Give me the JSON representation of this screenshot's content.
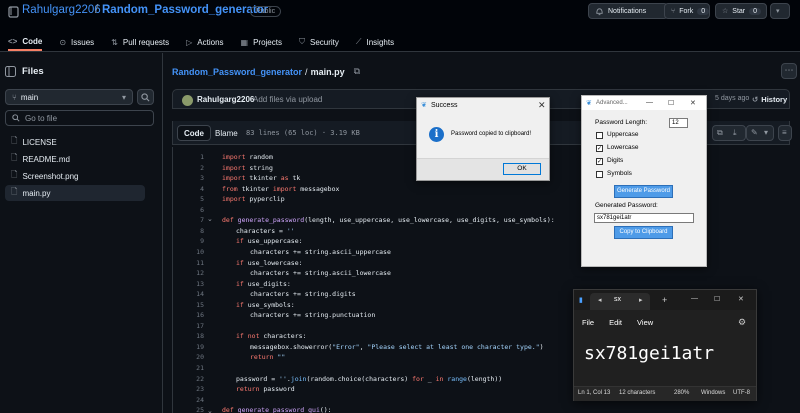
{
  "header": {
    "owner": "Rahulgarg2206",
    "separator": "/",
    "repo": "Random_Password_generator",
    "visibility": "Public",
    "notifications_label": "Notifications",
    "fork_label": "Fork",
    "fork_count": "0",
    "star_label": "Star",
    "star_count": "0"
  },
  "nav": [
    {
      "label": "Code",
      "icon": "code-icon",
      "active": true
    },
    {
      "label": "Issues",
      "icon": "issue-icon"
    },
    {
      "label": "Pull requests",
      "icon": "pull-request-icon"
    },
    {
      "label": "Actions",
      "icon": "play-icon"
    },
    {
      "label": "Projects",
      "icon": "table-icon"
    },
    {
      "label": "Security",
      "icon": "shield-icon"
    },
    {
      "label": "Insights",
      "icon": "graph-icon"
    }
  ],
  "tree": {
    "title": "Files",
    "branch": "main",
    "goto_placeholder": "Go to file",
    "files": [
      "LICENSE",
      "README.md",
      "Screenshot.png",
      "main.py"
    ]
  },
  "main": {
    "crumb_repo": "Random_Password_generator",
    "crumb_sep": "/",
    "crumb_file": "main.py",
    "commit_author": "Rahulgarg2206",
    "commit_message": "Add files via upload",
    "commit_time": "5 days ago",
    "history_label": "History",
    "code_tab": "Code",
    "blame_tab": "Blame",
    "file_meta": "83 lines (65 loc) · 3.19 KB"
  },
  "code_lines": [
    {
      "n": "1",
      "indent": 0,
      "parts": [
        [
          "kw",
          "import"
        ],
        [
          "t",
          " random"
        ]
      ]
    },
    {
      "n": "2",
      "indent": 0,
      "parts": [
        [
          "kw",
          "import"
        ],
        [
          "t",
          " string"
        ]
      ]
    },
    {
      "n": "3",
      "indent": 0,
      "parts": [
        [
          "kw",
          "import"
        ],
        [
          "t",
          " tkinter "
        ],
        [
          "kw",
          "as"
        ],
        [
          "t",
          " tk"
        ]
      ]
    },
    {
      "n": "4",
      "indent": 0,
      "parts": [
        [
          "kw",
          "from"
        ],
        [
          "t",
          " tkinter "
        ],
        [
          "kw",
          "import"
        ],
        [
          "t",
          " messagebox"
        ]
      ]
    },
    {
      "n": "5",
      "indent": 0,
      "parts": [
        [
          "kw",
          "import"
        ],
        [
          "t",
          " pyperclip"
        ]
      ]
    },
    {
      "n": "6",
      "indent": 0,
      "parts": []
    },
    {
      "n": "7",
      "indent": 0,
      "parts": [
        [
          "kw",
          "def"
        ],
        [
          "t",
          " "
        ],
        [
          "fn",
          "generate_password"
        ],
        [
          "t",
          "(length, use_uppercase, use_lowercase, use_digits, use_symbols):"
        ]
      ]
    },
    {
      "n": "8",
      "indent": 1,
      "parts": [
        [
          "t",
          "characters = "
        ],
        [
          "st",
          "''"
        ]
      ]
    },
    {
      "n": "9",
      "indent": 1,
      "parts": [
        [
          "kw",
          "if"
        ],
        [
          "t",
          " use_uppercase:"
        ]
      ]
    },
    {
      "n": "10",
      "indent": 2,
      "parts": [
        [
          "t",
          "characters += string.ascii_uppercase"
        ]
      ]
    },
    {
      "n": "11",
      "indent": 1,
      "parts": [
        [
          "kw",
          "if"
        ],
        [
          "t",
          " use_lowercase:"
        ]
      ]
    },
    {
      "n": "12",
      "indent": 2,
      "parts": [
        [
          "t",
          "characters += string.ascii_lowercase"
        ]
      ]
    },
    {
      "n": "13",
      "indent": 1,
      "parts": [
        [
          "kw",
          "if"
        ],
        [
          "t",
          " use_digits:"
        ]
      ]
    },
    {
      "n": "14",
      "indent": 2,
      "parts": [
        [
          "t",
          "characters += string.digits"
        ]
      ]
    },
    {
      "n": "15",
      "indent": 1,
      "parts": [
        [
          "kw",
          "if"
        ],
        [
          "t",
          " use_symbols:"
        ]
      ]
    },
    {
      "n": "16",
      "indent": 2,
      "parts": [
        [
          "t",
          "characters += string.punctuation"
        ]
      ]
    },
    {
      "n": "17",
      "indent": 0,
      "parts": []
    },
    {
      "n": "18",
      "indent": 1,
      "parts": [
        [
          "kw",
          "if not"
        ],
        [
          "t",
          " characters:"
        ]
      ]
    },
    {
      "n": "19",
      "indent": 2,
      "parts": [
        [
          "t",
          "messagebox.showerror("
        ],
        [
          "st",
          "\"Error\""
        ],
        [
          "t",
          ", "
        ],
        [
          "st",
          "\"Please select at least one character type.\""
        ],
        [
          "t",
          ")"
        ]
      ]
    },
    {
      "n": "20",
      "indent": 2,
      "parts": [
        [
          "kw",
          "return"
        ],
        [
          "t",
          " "
        ],
        [
          "st",
          "\"\""
        ]
      ]
    },
    {
      "n": "21",
      "indent": 0,
      "parts": []
    },
    {
      "n": "22",
      "indent": 1,
      "parts": [
        [
          "t",
          "password = "
        ],
        [
          "st",
          "''"
        ],
        [
          "t",
          "."
        ],
        [
          "nb",
          "join"
        ],
        [
          "t",
          "(random.choice(characters) "
        ],
        [
          "kw",
          "for"
        ],
        [
          "t",
          " _ "
        ],
        [
          "kw",
          "in"
        ],
        [
          "t",
          " "
        ],
        [
          "nb",
          "range"
        ],
        [
          "t",
          "(length))"
        ]
      ]
    },
    {
      "n": "23",
      "indent": 1,
      "parts": [
        [
          "kw",
          "return"
        ],
        [
          "t",
          " password"
        ]
      ]
    },
    {
      "n": "24",
      "indent": 0,
      "parts": []
    },
    {
      "n": "25",
      "indent": 0,
      "parts": [
        [
          "kw",
          "def"
        ],
        [
          "t",
          " "
        ],
        [
          "fn",
          "generate_password_gui"
        ],
        [
          "t",
          "():"
        ]
      ]
    }
  ],
  "success_dialog": {
    "title": "Success",
    "message": "Password copied to clipboard!",
    "ok_label": "OK"
  },
  "tk_window": {
    "title": "Advanced...",
    "length_label": "Password Length:",
    "length_value": "12",
    "options": [
      {
        "label": "Uppercase",
        "checked": false
      },
      {
        "label": "Lowercase",
        "checked": true
      },
      {
        "label": "Digits",
        "checked": true
      },
      {
        "label": "Symbols",
        "checked": false
      }
    ],
    "generate_label": "Generate Password",
    "generated_label": "Generated Password:",
    "generated_value": "sx781gei1atr",
    "copy_label": "Copy to Clipboard"
  },
  "notepad": {
    "tab_title": "sx",
    "menu": [
      "File",
      "Edit",
      "View"
    ],
    "content": "sx781gei1atr",
    "status": {
      "position": "Ln 1, Col 13",
      "chars": "12 characters",
      "zoom": "280%",
      "line_ending": "Windows",
      "encoding": "UTF-8"
    }
  },
  "colors": {
    "bg": "#0d1117",
    "link": "#4493f8",
    "accent_underline": "#f78166",
    "tk_button": "#4e9be8"
  }
}
